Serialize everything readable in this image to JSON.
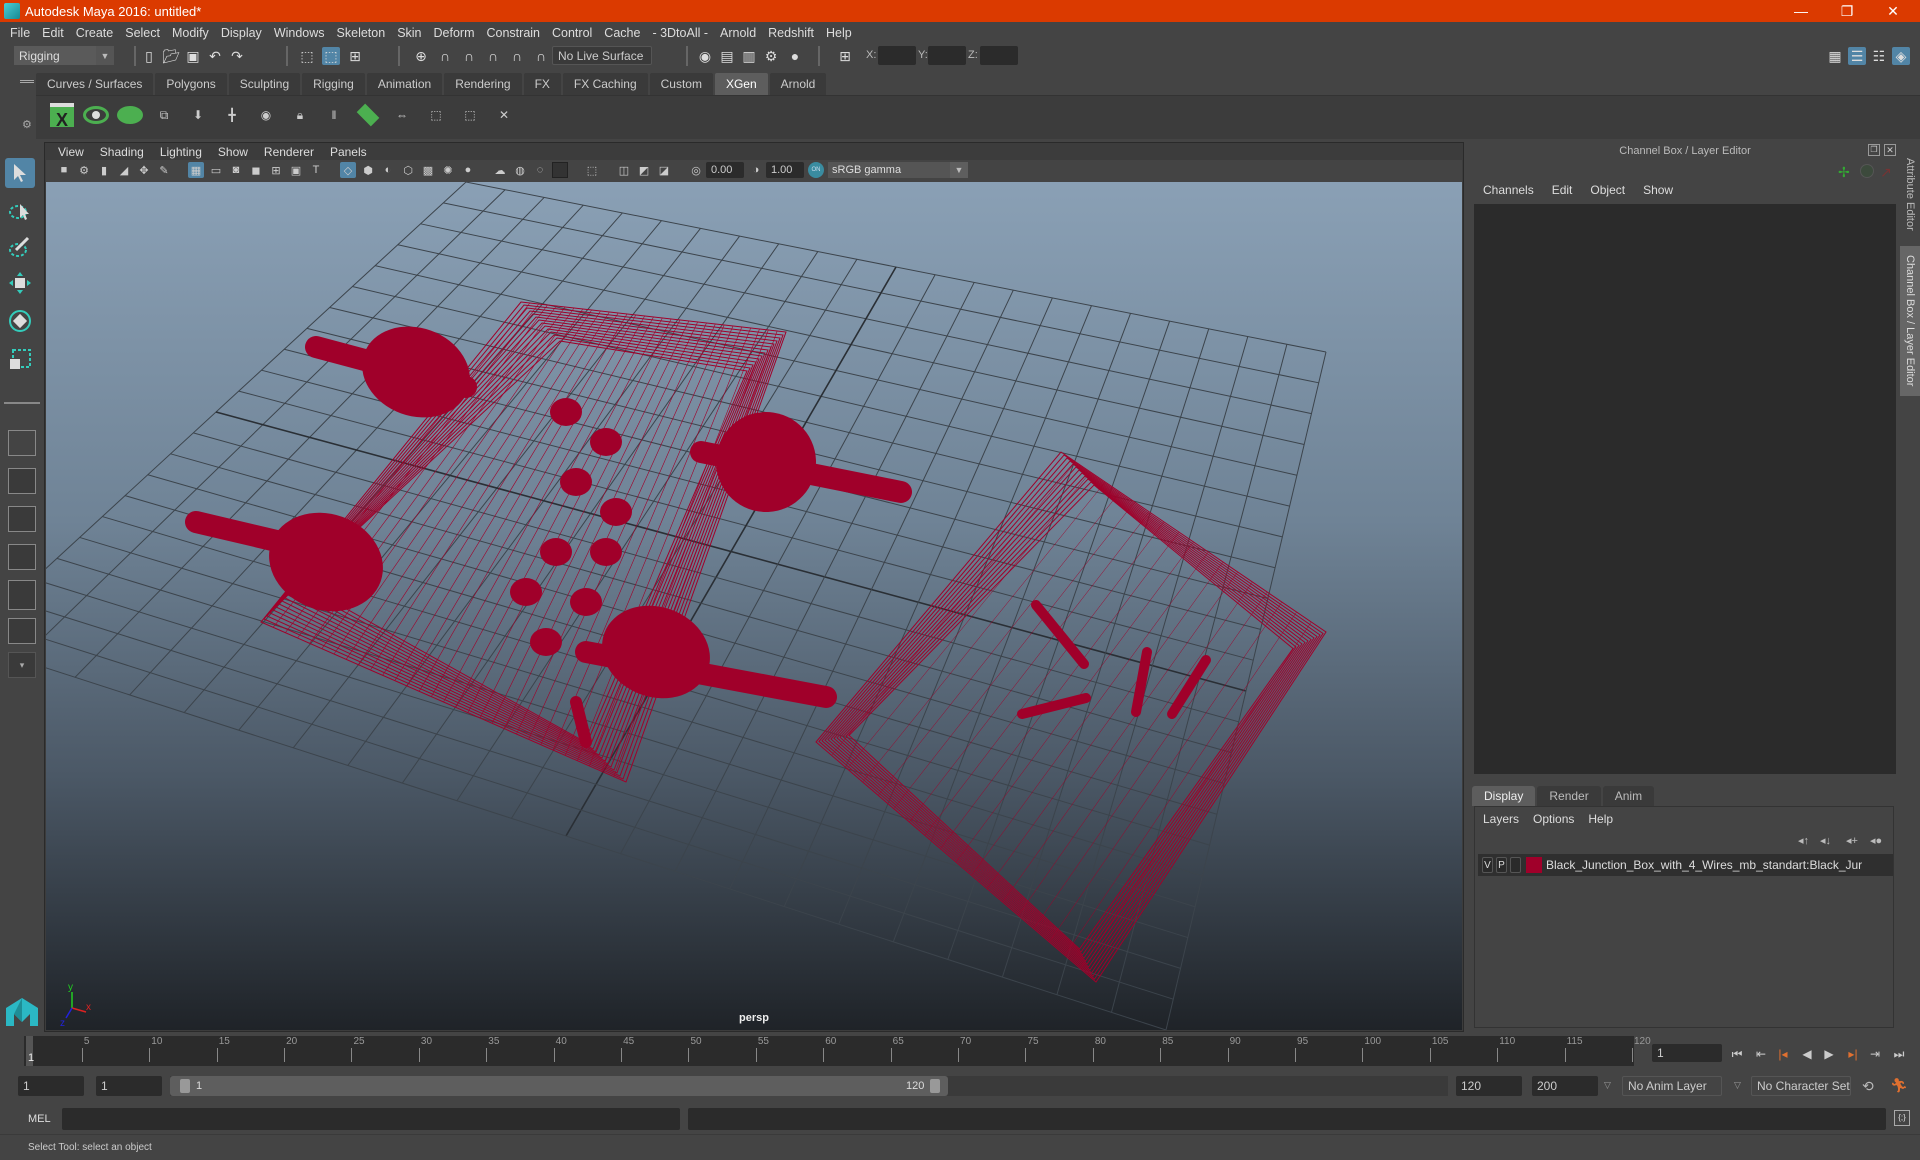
{
  "app": {
    "title": "Autodesk Maya 2016: untitled*",
    "window_controls": {
      "minimize": "—",
      "restore": "❐",
      "close": "✕"
    }
  },
  "menubar": [
    "File",
    "Edit",
    "Create",
    "Select",
    "Modify",
    "Display",
    "Windows",
    "Skeleton",
    "Skin",
    "Deform",
    "Constrain",
    "Control",
    "Cache",
    "- 3DtoAll -",
    "Arnold",
    "Redshift",
    "Help"
  ],
  "toolbar": {
    "mode": "Rigging",
    "live_surface": "No Live Surface",
    "x_label": "X:",
    "y_label": "Y:",
    "z_label": "Z:",
    "x_value": "",
    "y_value": "",
    "z_value": ""
  },
  "shelf": {
    "tabs": [
      "Curves / Surfaces",
      "Polygons",
      "Sculpting",
      "Rigging",
      "Animation",
      "Rendering",
      "FX",
      "FX Caching",
      "Custom",
      "XGen",
      "Arnold"
    ],
    "active_tab": "XGen",
    "icons": [
      "xgen-window-icon",
      "preview-icon",
      "clear-preview-icon",
      "add-descriptions-icon",
      "move-guides-icon",
      "add-guide-icon",
      "view-guide-icon",
      "lock-guide-icon",
      "split-guide-icon",
      "paint-density-icon",
      "rebuild-guides-icon",
      "select-guides-icon",
      "guide-frame-icon",
      "delete-guides-icon"
    ]
  },
  "viewport": {
    "menu": [
      "View",
      "Shading",
      "Lighting",
      "Show",
      "Renderer",
      "Panels"
    ],
    "exposure": "0.00",
    "gamma": "1.00",
    "color_mgmt_badge": "ON",
    "color_space": "sRGB gamma",
    "camera": "persp",
    "axis": {
      "x": "x",
      "y": "y",
      "z": "z"
    },
    "wireframe_color": "#a0002a"
  },
  "right_panel": {
    "title": "Channel Box / Layer Editor",
    "channel_menu": [
      "Channels",
      "Edit",
      "Object",
      "Show"
    ],
    "layer_tabs": [
      "Display",
      "Render",
      "Anim"
    ],
    "active_layer_tab": "Display",
    "layer_menu": [
      "Layers",
      "Options",
      "Help"
    ],
    "layers": [
      {
        "visible": "V",
        "playback": "P",
        "color": "#a0002a",
        "name": "Black_Junction_Box_with_4_Wires_mb_standart:Black_Jur"
      }
    ],
    "side_tabs": [
      "Attribute Editor",
      "Channel Box / Layer Editor"
    ]
  },
  "timeline": {
    "ticks": [
      "5",
      "10",
      "15",
      "20",
      "25",
      "30",
      "35",
      "40",
      "45",
      "50",
      "55",
      "60",
      "65",
      "70",
      "75",
      "80",
      "85",
      "90",
      "95",
      "100",
      "105",
      "110",
      "115",
      "120"
    ],
    "current_frame": "1",
    "current_frame_marker": "1",
    "min_frame": 1,
    "max_frame": 120
  },
  "range": {
    "start": "1",
    "playback_start": "1",
    "slider_start": "1",
    "slider_end": "120",
    "playback_end": "120",
    "end": "200",
    "anim_layer": "No Anim Layer",
    "character_set": "No Character Set"
  },
  "command_line": {
    "label": "MEL",
    "value": ""
  },
  "status": {
    "message": "Select Tool: select an object"
  }
}
